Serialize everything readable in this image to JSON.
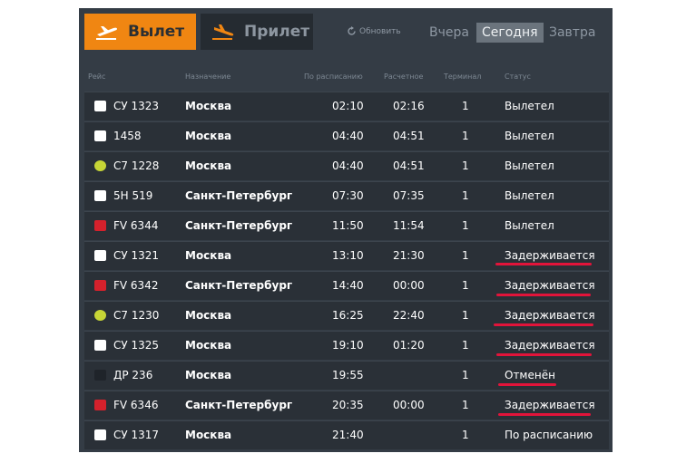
{
  "tabs": {
    "departures": "Вылет",
    "arrivals": "Прилет"
  },
  "refresh_label": "Обновить",
  "days": [
    "Вчера",
    "Сегодня",
    "Завтра"
  ],
  "selected_day": "Сегодня",
  "columns": {
    "flight": "Рейс",
    "destination": "Назначение",
    "scheduled": "По расписанию",
    "estimated": "Расчетное",
    "terminal": "Терминал",
    "status": "Статус"
  },
  "flights": [
    {
      "flight": "СУ 1323",
      "destination": "Москва",
      "scheduled": "02:10",
      "estimated": "02:16",
      "terminal": "1",
      "status": "Вылетел",
      "airline_logo": "aeroflot-logo"
    },
    {
      "flight": "1458",
      "destination": "Москва",
      "scheduled": "04:40",
      "estimated": "04:51",
      "terminal": "1",
      "status": "Вылетел",
      "airline_logo": "airline-k-logo"
    },
    {
      "flight": "С7 1228",
      "destination": "Москва",
      "scheduled": "04:40",
      "estimated": "04:51",
      "terminal": "1",
      "status": "Вылетел",
      "airline_logo": "s7-logo"
    },
    {
      "flight": "5Н 519",
      "destination": "Санкт-Петербург",
      "scheduled": "07:30",
      "estimated": "07:35",
      "terminal": "1",
      "status": "Вылетел",
      "airline_logo": "nordstar-logo"
    },
    {
      "flight": "FV 6344",
      "destination": "Санкт-Петербург",
      "scheduled": "11:50",
      "estimated": "11:54",
      "terminal": "1",
      "status": "Вылетел",
      "airline_logo": "rossiya-logo"
    },
    {
      "flight": "СУ 1321",
      "destination": "Москва",
      "scheduled": "13:10",
      "estimated": "21:30",
      "terminal": "1",
      "status": "Задерживается",
      "airline_logo": "aeroflot-logo"
    },
    {
      "flight": "FV 6342",
      "destination": "Санкт-Петербург",
      "scheduled": "14:40",
      "estimated": "00:00",
      "terminal": "1",
      "status": "Задерживается",
      "airline_logo": "rossiya-logo"
    },
    {
      "flight": "С7 1230",
      "destination": "Москва",
      "scheduled": "16:25",
      "estimated": "22:40",
      "terminal": "1",
      "status": "Задерживается",
      "airline_logo": "s7-logo"
    },
    {
      "flight": "СУ 1325",
      "destination": "Москва",
      "scheduled": "19:10",
      "estimated": "01:20",
      "terminal": "1",
      "status": "Задерживается",
      "airline_logo": "aeroflot-logo"
    },
    {
      "flight": "ДР 236",
      "destination": "Москва",
      "scheduled": "19:55",
      "estimated": "",
      "terminal": "1",
      "status": "Отменён",
      "airline_logo": "pobeda-logo"
    },
    {
      "flight": "FV 6346",
      "destination": "Санкт-Петербург",
      "scheduled": "20:35",
      "estimated": "00:00",
      "terminal": "1",
      "status": "Задерживается",
      "airline_logo": "rossiya-logo"
    },
    {
      "flight": "СУ 1317",
      "destination": "Москва",
      "scheduled": "21:40",
      "estimated": "",
      "terminal": "1",
      "status": "По расписанию",
      "airline_logo": "aeroflot-logo"
    }
  ],
  "colors": {
    "board_bg": "#343c45",
    "row_bg": "#2a3037",
    "active_tab": "#f08612",
    "highlight_underline": "#e2143a"
  }
}
